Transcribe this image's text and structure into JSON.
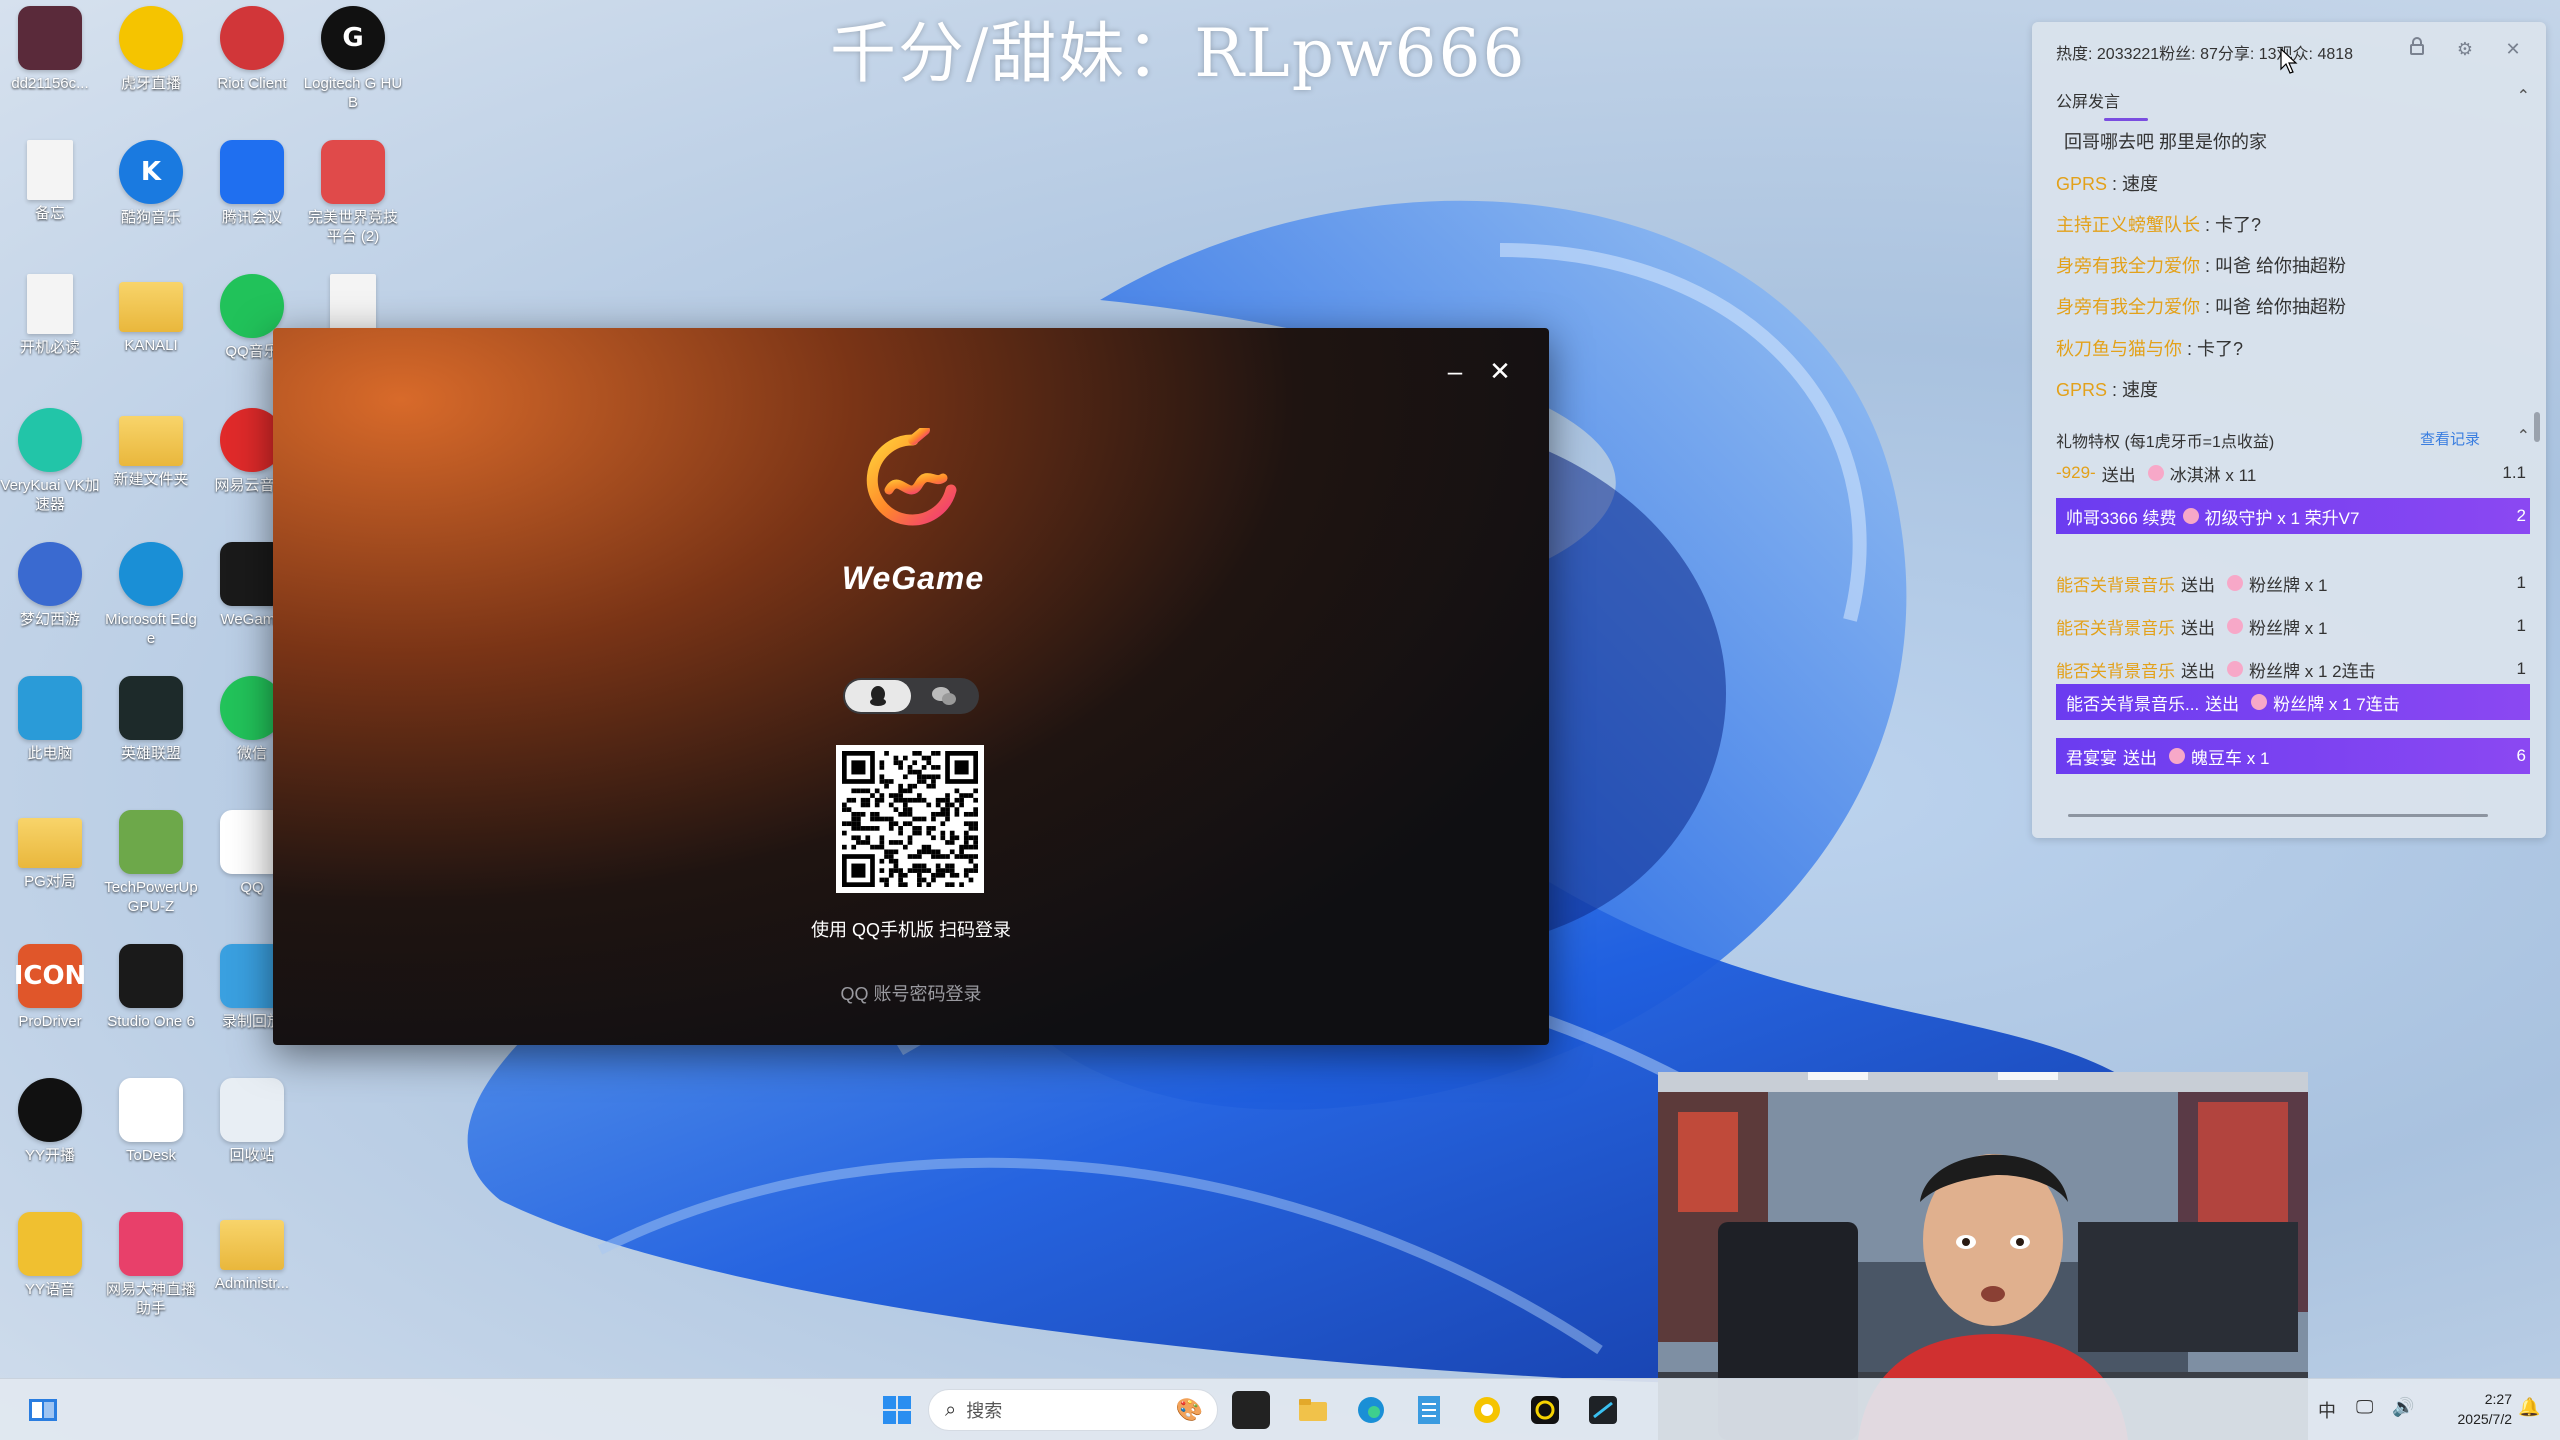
{
  "overlay": {
    "stream_title": "千分/甜妹：RLpw666"
  },
  "desktop": {
    "icons": [
      {
        "label": "dd21156c...",
        "glyph": "",
        "icon": "game-avatar-icon",
        "color": "#5a2a3a"
      },
      {
        "label": "虎牙直播",
        "glyph": "",
        "icon": "huya-live-icon",
        "color": "#f5c400"
      },
      {
        "label": "Riot Client",
        "glyph": "",
        "icon": "riot-client-icon",
        "color": "#d13639"
      },
      {
        "label": "Logitech G HUB",
        "glyph": "G",
        "icon": "logitech-ghub-icon",
        "color": "#111111"
      },
      {
        "label": "备忘",
        "glyph": "",
        "icon": "document-icon",
        "color": "#f4f4f4"
      },
      {
        "label": "酷狗音乐",
        "glyph": "K",
        "icon": "kugou-icon",
        "color": "#1a7ae0"
      },
      {
        "label": "腾讯会议",
        "glyph": "",
        "icon": "tencent-meeting-icon",
        "color": "#1f6ff0"
      },
      {
        "label": "完美世界竞技平台 (2)",
        "glyph": "",
        "icon": "perfect-world-icon",
        "color": "#e04a4a"
      },
      {
        "label": "开机必读",
        "glyph": "",
        "icon": "document-icon",
        "color": "#f4f4f4"
      },
      {
        "label": "KANALI",
        "glyph": "",
        "icon": "folder-icon",
        "color": "#f1c24a"
      },
      {
        "label": "QQ音乐",
        "glyph": "",
        "icon": "qq-music-icon",
        "color": "#21c25a"
      },
      {
        "label": "",
        "glyph": "",
        "icon": "document-icon",
        "color": "#f4f4f4"
      },
      {
        "label": "VeryKuai VK加速器",
        "glyph": "",
        "icon": "verykuai-icon",
        "color": "#22c5a8"
      },
      {
        "label": "新建文件夹",
        "glyph": "",
        "icon": "folder-icon",
        "color": "#f1c24a"
      },
      {
        "label": "网易云音乐",
        "glyph": "",
        "icon": "netease-music-icon",
        "color": "#e02a2a"
      },
      {
        "label": "梦幻西游",
        "glyph": "",
        "icon": "menghuan-icon",
        "color": "#3a6ad0"
      },
      {
        "label": "Microsoft Edge",
        "glyph": "",
        "icon": "edge-icon",
        "color": "#1a8fd6"
      },
      {
        "label": "WeGame",
        "glyph": "",
        "icon": "wegame-icon",
        "color": "#1a1a1a"
      },
      {
        "label": "此电脑",
        "glyph": "",
        "icon": "this-pc-icon",
        "color": "#2a9bd8"
      },
      {
        "label": "英雄联盟",
        "glyph": "",
        "icon": "league-icon",
        "color": "#1d2a2a"
      },
      {
        "label": "微信",
        "glyph": "",
        "icon": "wechat-icon",
        "color": "#22c35a"
      },
      {
        "label": "PG对局",
        "glyph": "",
        "icon": "folder-icon",
        "color": "#f1c24a"
      },
      {
        "label": "TechPowerUp GPU-Z",
        "glyph": "",
        "icon": "gpu-z-icon",
        "color": "#6da84a"
      },
      {
        "label": "QQ",
        "glyph": "",
        "icon": "qq-icon",
        "color": "#ffffff"
      },
      {
        "label": "ProDriver",
        "glyph": "ICON",
        "icon": "prodriver-icon",
        "color": "#e0562a"
      },
      {
        "label": "Studio One 6",
        "glyph": "",
        "icon": "studio-one-icon",
        "color": "#1a1a1a"
      },
      {
        "label": "录制回放",
        "glyph": "",
        "icon": "recording-icon",
        "color": "#3aa0e0"
      },
      {
        "label": "YY开播",
        "glyph": "",
        "icon": "yy-live-icon",
        "color": "#111111"
      },
      {
        "label": "ToDesk",
        "glyph": "",
        "icon": "todesk-icon",
        "color": "#ffffff"
      },
      {
        "label": "回收站",
        "glyph": "",
        "icon": "recycle-bin-icon",
        "color": "#e8eef4"
      },
      {
        "label": "YY语音",
        "glyph": "",
        "icon": "yy-voice-icon",
        "color": "#f0c030"
      },
      {
        "label": "网易大神直播助手",
        "glyph": "",
        "icon": "netease-live-icon",
        "color": "#e8406a"
      },
      {
        "label": "Administr...",
        "glyph": "",
        "icon": "folder-icon",
        "color": "#f1c24a"
      }
    ]
  },
  "wegame": {
    "brand": "WeGame",
    "scan_text": "使用 QQ手机版 扫码登录",
    "password_link": "QQ 账号密码登录"
  },
  "chat": {
    "stats": "热度: 2033221粉丝: 87分享: 13观众: 4818",
    "public_section": "公屏发言",
    "messages": [
      {
        "name": "",
        "text": "回哥哪去吧 那里是你的家"
      },
      {
        "name": "GPRS",
        "text": "速度"
      },
      {
        "name": "主持正义螃蟹队长",
        "text": "卡了?"
      },
      {
        "name": "身旁有我全力爱你",
        "text": "叫爸 给你抽超粉"
      },
      {
        "name": "身旁有我全力爱你",
        "text": "叫爸 给你抽超粉"
      },
      {
        "name": "秋刀鱼与猫与你",
        "text": "卡了?"
      },
      {
        "name": "GPRS",
        "text": "速度"
      }
    ],
    "gift_section": "礼物特权 (每1虎牙币=1点收益)",
    "view_record": "查看记录",
    "gifts": [
      {
        "name": "-929-",
        "action": "送出",
        "item": "冰淇淋 x 11",
        "count": "1.1",
        "highlight": false
      },
      {
        "name": "帅哥3366 续费",
        "action": "",
        "item": "初级守护 x 1 荣升V7",
        "count": "2",
        "highlight": true
      },
      {
        "name": "能否关背景音乐",
        "action": "送出",
        "item": "粉丝牌 x 1",
        "count": "1",
        "highlight": false
      },
      {
        "name": "能否关背景音乐",
        "action": "送出",
        "item": "粉丝牌 x 1",
        "count": "1",
        "highlight": false
      },
      {
        "name": "能否关背景音乐",
        "action": "送出",
        "item": "粉丝牌 x 1 2连击",
        "count": "1",
        "highlight": false
      },
      {
        "name": "能否关背景音乐...",
        "action": "送出",
        "item": "粉丝牌 x 1 7连击",
        "count": "",
        "highlight": true
      },
      {
        "name": "君宴宴",
        "action": "送出",
        "item": "魄豆车 x 1",
        "count": "6",
        "highlight": true
      }
    ]
  },
  "taskbar": {
    "search_placeholder": "搜索",
    "ime": "中",
    "time": "2:27",
    "date": "2025/7/2"
  }
}
